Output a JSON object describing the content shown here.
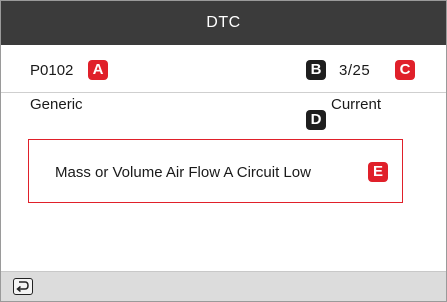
{
  "header": {
    "title": "DTC"
  },
  "dtc": {
    "code": "P0102",
    "index": "3/25",
    "type": "Generic",
    "status": "Current",
    "description": "Mass or Volume Air Flow A Circuit Low"
  },
  "callouts": {
    "a": "A",
    "b": "B",
    "c": "C",
    "d": "D",
    "e": "E"
  },
  "footer": {
    "back_icon": "return-icon"
  },
  "colors": {
    "title_bar": "#3b3b3b",
    "badge_red": "#e0202a",
    "badge_dark": "#1e1e1e",
    "footer_bg": "#dcdcdc"
  }
}
